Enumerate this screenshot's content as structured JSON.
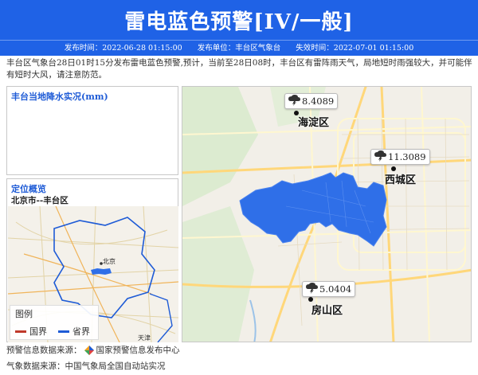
{
  "header": {
    "title": "雷电蓝色预警[IV/一般]",
    "issue_time": "发布时间：2022-06-28 01:15:00",
    "issuer": "发布单位：丰台区气象台",
    "expire_time": "失效时间：2022-07-01 01:15:00"
  },
  "description": "丰台区气象台28日01时15分发布雷电蓝色预警,预计，当前至28日08时，丰台区有雷阵雨天气，局地短时雨强较大，并可能伴有短时大风，请注意防范。",
  "rain_panel": {
    "title": "丰台当地降水实况(mm)"
  },
  "location_panel": {
    "title": "定位概览",
    "place": "北京市--丰台区",
    "map_labels": {
      "beijing": "北京",
      "tianjin": "天津"
    }
  },
  "legend": {
    "title": "图例",
    "items": [
      {
        "label": "国界",
        "color": "#c0392b"
      },
      {
        "label": "省界",
        "color": "#1e5bd6"
      }
    ]
  },
  "main_map": {
    "stations": [
      {
        "value": "8.4089",
        "district": "海淀区"
      },
      {
        "value": "11.3089",
        "district": "西城区"
      },
      {
        "value": "5.0404",
        "district": "房山区"
      }
    ],
    "warning_area_color": "#2f6fe8"
  },
  "sources": {
    "warning": "预警信息数据来源：",
    "warning_org": "国家预警信息发布中心",
    "weather": "气象数据来源：中国气象局全国自动站实况"
  },
  "colors": {
    "accent": "#1f62e6"
  }
}
